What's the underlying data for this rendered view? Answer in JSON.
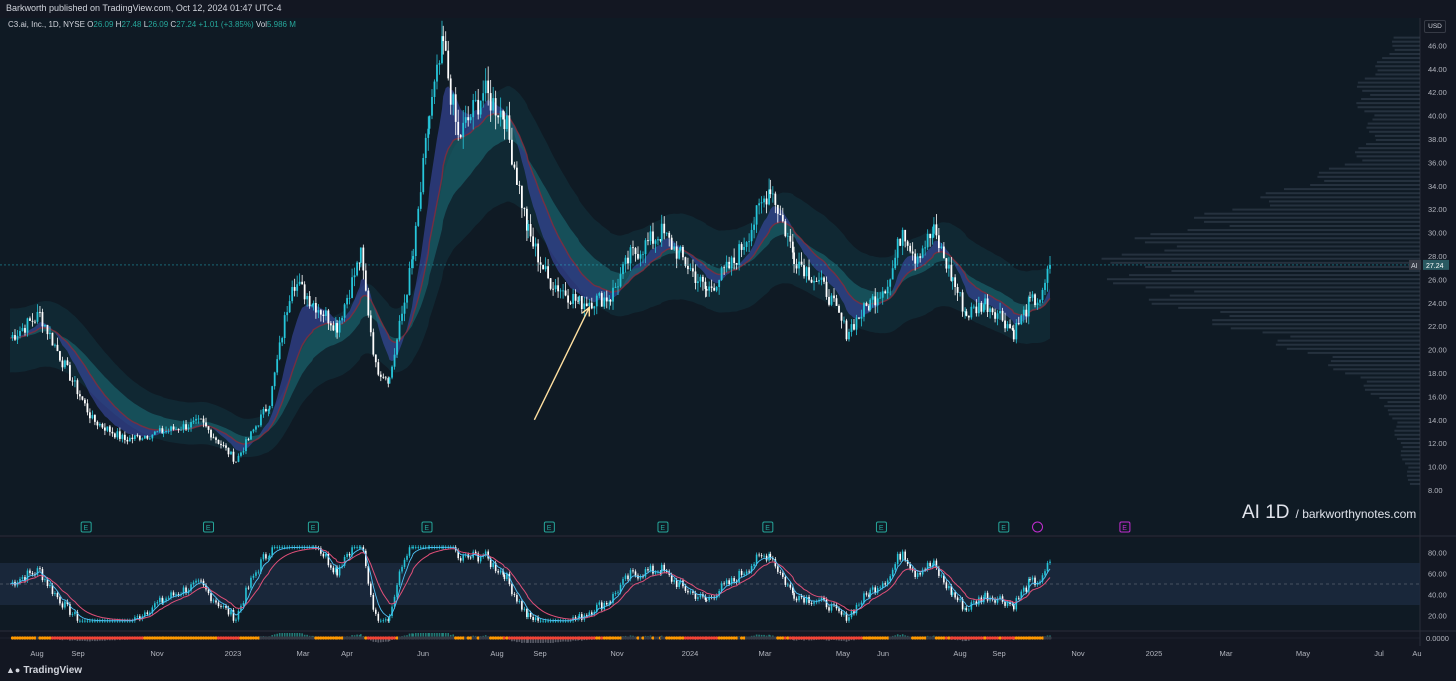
{
  "header": {
    "publisher": "Barkworth published on TradingView.com, Oct 12, 2024 01:47 UTC-4"
  },
  "legend": {
    "symbol": "C3.ai, Inc., 1D, NYSE",
    "o_label": "O",
    "o": "26.09",
    "h_label": "H",
    "h": "27.48",
    "l_label": "L",
    "l": "26.09",
    "c_label": "C",
    "c": "27.24",
    "change": "+1.01 (+3.85%)",
    "vol_label": "Vol",
    "vol": "5.986 M"
  },
  "price_axis": {
    "currency": "USD",
    "last_price_tag": "AI",
    "last_price": "27.24"
  },
  "watermark": {
    "title": "AI 1D",
    "subtitle": "/ barkworthynotes.com"
  },
  "earnings_marker_label": "E",
  "footer": {
    "logo_text": "TradingView"
  },
  "colors": {
    "background": "#131722",
    "up": "#26c6da",
    "down": "#ffffff",
    "ribbon_blue": "#3f51b5",
    "ribbon_red": "#8b2a3a",
    "ribbon_teal": "#1a5f6a",
    "arrow": "#ffe0a0",
    "earnings": "#26a69a",
    "earnings_upcoming": "#c22dd1",
    "osc_fast": "#4fc3f7",
    "osc_slow": "#e04f78",
    "strip_orange": "#ff9800",
    "strip_red": "#f44336"
  },
  "chart_data": {
    "type": "candlestick",
    "ylim": [
      8,
      48
    ],
    "yticks": [
      "8.00",
      "10.00",
      "12.00",
      "14.00",
      "16.00",
      "18.00",
      "20.00",
      "22.00",
      "24.00",
      "26.00",
      "28.00",
      "30.00",
      "32.00",
      "34.00",
      "36.00",
      "38.00",
      "40.00",
      "42.00",
      "44.00",
      "46.00"
    ],
    "xticks": [
      "Aug",
      "Sep",
      "Nov",
      "2023",
      "Mar",
      "Apr",
      "Jun",
      "Aug",
      "Sep",
      "Nov",
      "2024",
      "Mar",
      "May",
      "Jun",
      "Aug",
      "Sep",
      "Nov",
      "2025",
      "Mar",
      "May",
      "Jul",
      "Au"
    ],
    "price_path": [
      [
        "2022-07-01",
        21.0
      ],
      [
        "2022-07-25",
        23.0
      ],
      [
        "2022-08-12",
        19.0
      ],
      [
        "2022-09-05",
        14.0
      ],
      [
        "2022-10-01",
        12.3
      ],
      [
        "2022-11-01",
        13.0
      ],
      [
        "2022-12-01",
        13.8
      ],
      [
        "2022-12-29",
        10.5
      ],
      [
        "2023-01-25",
        15.5
      ],
      [
        "2023-02-12",
        26.0
      ],
      [
        "2023-03-01",
        24.0
      ],
      [
        "2023-03-20",
        22.0
      ],
      [
        "2023-04-08",
        28.0
      ],
      [
        "2023-04-20",
        18.5
      ],
      [
        "2023-05-01",
        17.5
      ],
      [
        "2023-05-20",
        28.0
      ],
      [
        "2023-06-02",
        40.0
      ],
      [
        "2023-06-13",
        46.0
      ],
      [
        "2023-06-25",
        38.0
      ],
      [
        "2023-07-15",
        42.0
      ],
      [
        "2023-08-01",
        40.0
      ],
      [
        "2023-08-20",
        30.0
      ],
      [
        "2023-09-05",
        26.0
      ],
      [
        "2023-09-30",
        24.0
      ],
      [
        "2023-10-25",
        24.5
      ],
      [
        "2023-11-10",
        28.0
      ],
      [
        "2023-12-05",
        30.0
      ],
      [
        "2023-12-20",
        28.0
      ],
      [
        "2024-01-10",
        25.0
      ],
      [
        "2024-02-01",
        27.5
      ],
      [
        "2024-02-15",
        30.5
      ],
      [
        "2024-03-01",
        34.0
      ],
      [
        "2024-03-20",
        28.0
      ],
      [
        "2024-04-15",
        25.0
      ],
      [
        "2024-05-01",
        21.5
      ],
      [
        "2024-05-20",
        24.0
      ],
      [
        "2024-06-05",
        26.0
      ],
      [
        "2024-06-15",
        30.5
      ],
      [
        "2024-06-25",
        28.0
      ],
      [
        "2024-07-10",
        30.0
      ],
      [
        "2024-07-25",
        26.0
      ],
      [
        "2024-08-05",
        23.0
      ],
      [
        "2024-08-20",
        24.0
      ],
      [
        "2024-09-01",
        23.0
      ],
      [
        "2024-09-12",
        21.5
      ],
      [
        "2024-09-25",
        24.0
      ],
      [
        "2024-10-05",
        24.5
      ],
      [
        "2024-10-11",
        27.24
      ]
    ],
    "earnings_dates": [
      "2022-08-31",
      "2022-12-07",
      "2023-03-01",
      "2023-05-31",
      "2023-09-06",
      "2023-12-06",
      "2024-02-28",
      "2024-05-29",
      "2024-09-04",
      "2024-10-01",
      "2024-12-10"
    ],
    "arrow": {
      "from": [
        "2023-08-25",
        14.0
      ],
      "to": [
        "2023-10-08",
        23.6
      ]
    },
    "oscillator": {
      "ylim": [
        10,
        90
      ],
      "yticks": [
        "20.00",
        "40.00",
        "60.00",
        "80.00"
      ],
      "band": [
        30,
        70
      ],
      "mid": 50
    },
    "momentum_strip": {
      "label": "0.0000"
    }
  }
}
